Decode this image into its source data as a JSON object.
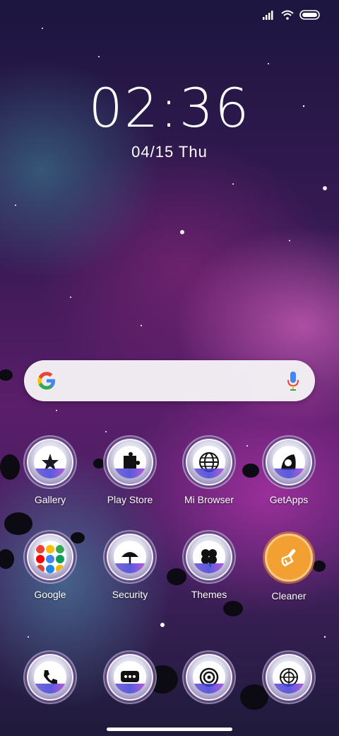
{
  "status_bar": {
    "signal_icon": "signal-bars-icon",
    "wifi_icon": "wifi-icon",
    "battery_icon": "battery-icon"
  },
  "lock_clock": {
    "time": "02:36",
    "date": "04/15 Thu"
  },
  "search_bar": {
    "google_icon": "google-g-icon",
    "mic_icon": "mic-icon"
  },
  "apps_row1": [
    {
      "label": "Gallery",
      "icon": "gallery-icon"
    },
    {
      "label": "Play Store",
      "icon": "play-store-icon"
    },
    {
      "label": "Mi Browser",
      "icon": "browser-globe-icon"
    },
    {
      "label": "GetApps",
      "icon": "getapps-icon"
    }
  ],
  "apps_row2": [
    {
      "label": "Google",
      "icon": "google-folder-icon"
    },
    {
      "label": "Security",
      "icon": "security-umbrella-icon"
    },
    {
      "label": "Themes",
      "icon": "themes-clover-icon"
    },
    {
      "label": "Cleaner",
      "icon": "cleaner-brush-icon"
    }
  ],
  "dock": [
    {
      "icon": "phone-icon"
    },
    {
      "icon": "messages-icon"
    },
    {
      "icon": "camera-icon"
    },
    {
      "icon": "settings-icon"
    }
  ],
  "colors": {
    "cleaner_accent": "#f3a032",
    "search_bg": "#f5f2f6"
  }
}
